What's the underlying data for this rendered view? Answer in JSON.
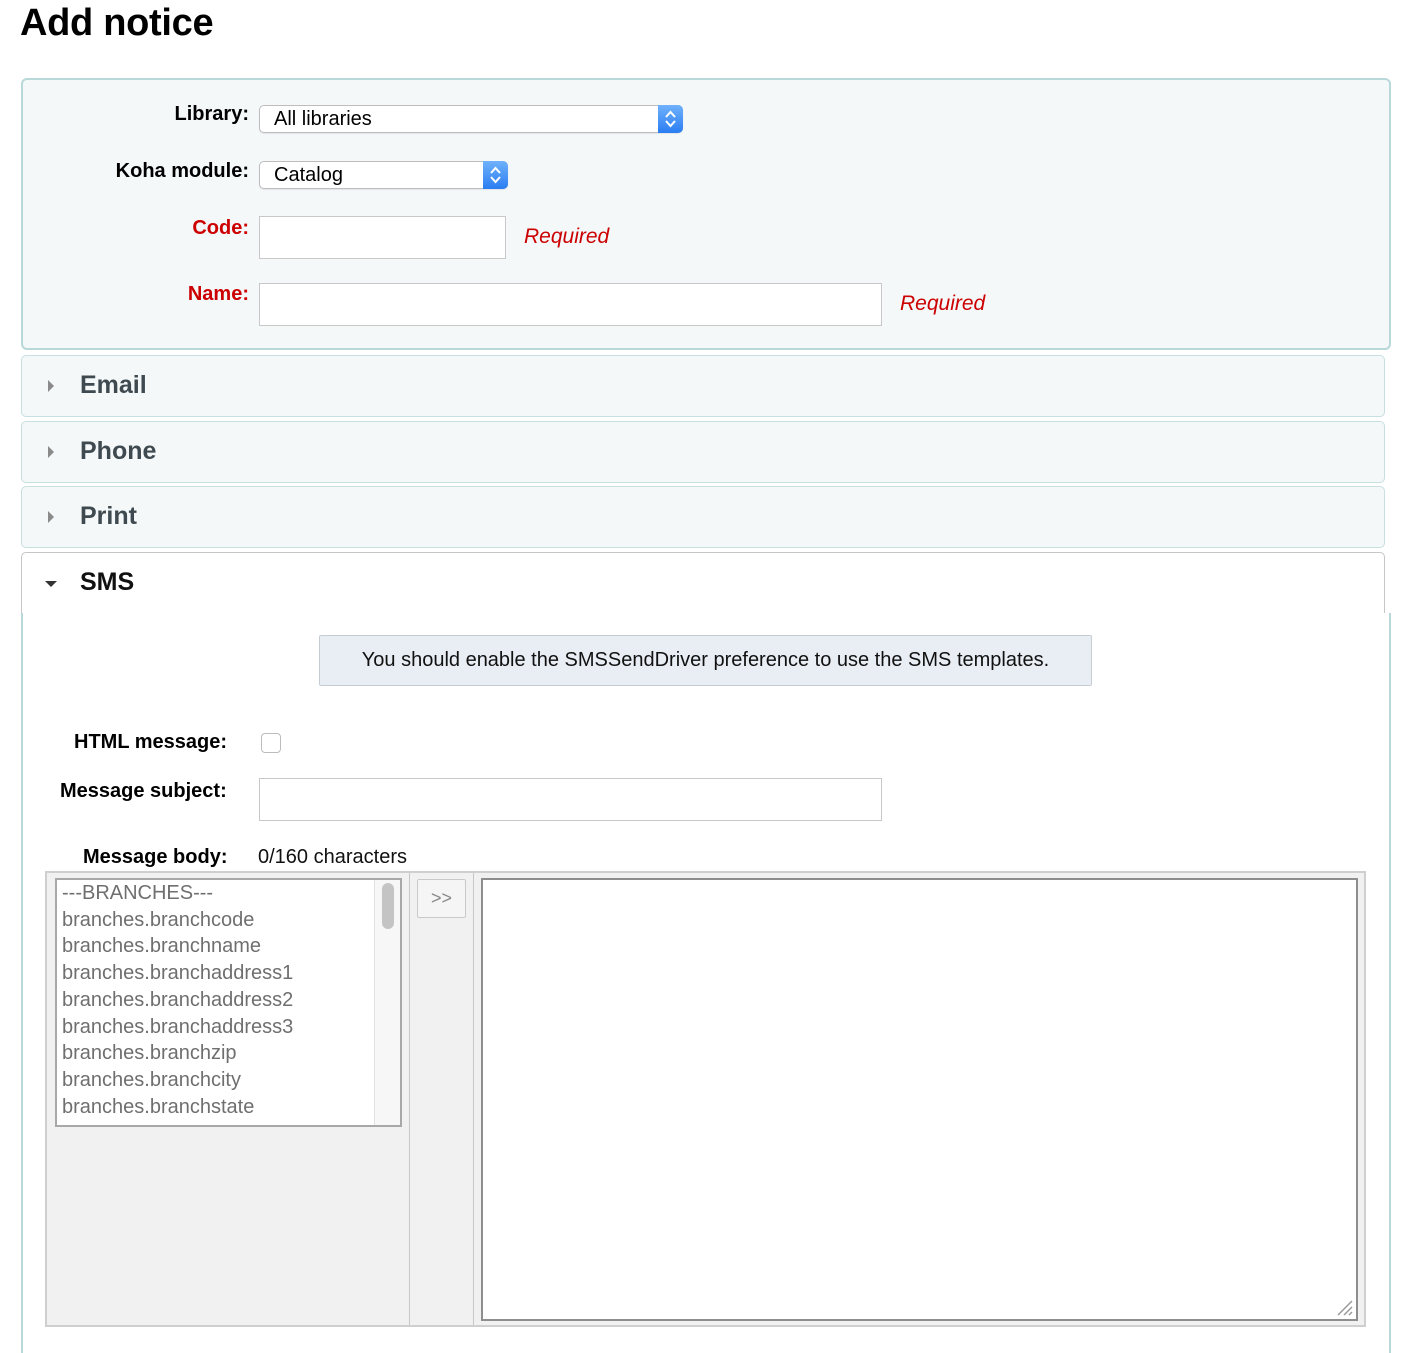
{
  "page": {
    "title": "Add notice"
  },
  "form": {
    "library": {
      "label": "Library:",
      "value": "All libraries"
    },
    "module": {
      "label": "Koha module:",
      "value": "Catalog"
    },
    "code": {
      "label": "Code:",
      "value": "",
      "hint": "Required"
    },
    "name": {
      "label": "Name:",
      "value": "",
      "hint": "Required"
    }
  },
  "sections": {
    "email": "Email",
    "phone": "Phone",
    "print": "Print",
    "sms": "SMS"
  },
  "sms": {
    "notice": "You should enable the SMSSendDriver preference to use the SMS templates.",
    "html_label": "HTML message:",
    "subject_label": "Message subject:",
    "subject_value": "",
    "body_label": "Message body:",
    "counter": "0/160 characters",
    "insert_label": ">>",
    "body_value": "",
    "fields": [
      "---BRANCHES---",
      "branches.branchcode",
      "branches.branchname",
      "branches.branchaddress1",
      "branches.branchaddress2",
      "branches.branchaddress3",
      "branches.branchzip",
      "branches.branchcity",
      "branches.branchstate"
    ]
  },
  "colors": {
    "required": "#cc0000",
    "panel_border": "#b9d8d9",
    "select_arrow": "#2a7df2"
  }
}
